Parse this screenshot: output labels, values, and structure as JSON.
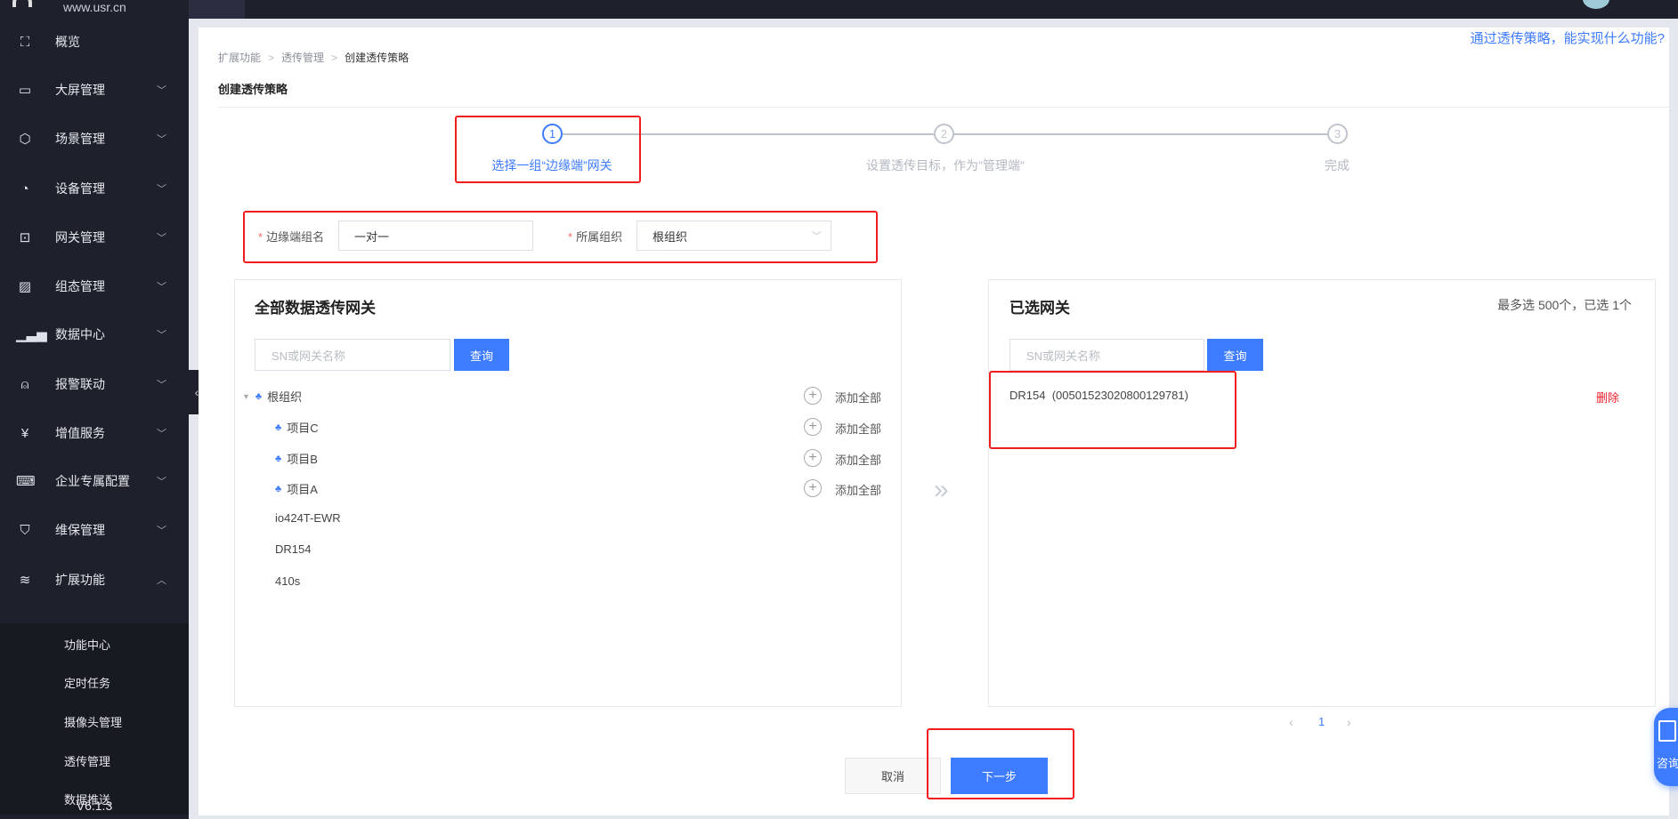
{
  "header": {
    "logo_url": "www.usr.cn"
  },
  "sidebar": {
    "items": [
      {
        "label": "概览",
        "icon": "overview-icon"
      },
      {
        "label": "大屏管理",
        "icon": "monitor-icon"
      },
      {
        "label": "场景管理",
        "icon": "cube-icon"
      },
      {
        "label": "设备管理",
        "icon": "pie-icon"
      },
      {
        "label": "网关管理",
        "icon": "gateway-icon"
      },
      {
        "label": "组态管理",
        "icon": "image-icon"
      },
      {
        "label": "数据中心",
        "icon": "bar-chart-icon"
      },
      {
        "label": "报警联动",
        "icon": "alarm-icon"
      },
      {
        "label": "增值服务",
        "icon": "yen-icon"
      },
      {
        "label": "企业专属配置",
        "icon": "code-monitor-icon"
      },
      {
        "label": "维保管理",
        "icon": "shield-icon"
      },
      {
        "label": "扩展功能",
        "icon": "layers-icon"
      }
    ],
    "subitems": [
      "功能中心",
      "定时任务",
      "摄像头管理",
      "透传管理",
      "数据推送"
    ],
    "version": "V6.1.3"
  },
  "breadcrumb": [
    "扩展功能",
    "透传管理",
    "创建透传策略"
  ],
  "help_link": "通过透传策略，能实现什么功能?",
  "page_title": "创建透传策略",
  "steps": [
    {
      "num": "1",
      "label": "选择一组“边缘端”网关",
      "active": true
    },
    {
      "num": "2",
      "label": "设置透传目标，作为\"管理端\"",
      "active": false
    },
    {
      "num": "3",
      "label": "完成",
      "active": false
    }
  ],
  "form": {
    "group_name_label": "边缘端组名",
    "group_name_value": "一对一",
    "org_label": "所属组织",
    "org_value": "根组织",
    "required_mark": "*"
  },
  "left_panel": {
    "title": "全部数据透传网关",
    "search_placeholder": "SN或网关名称",
    "search_button": "查询",
    "add_all_label": "添加全部",
    "tree": [
      {
        "label": "根组织",
        "type": "org"
      },
      {
        "label": "项目C",
        "type": "org"
      },
      {
        "label": "项目B",
        "type": "org"
      },
      {
        "label": "项目A",
        "type": "org"
      },
      {
        "label": "io424T-EWR",
        "type": "gateway"
      },
      {
        "label": "DR154",
        "type": "gateway"
      },
      {
        "label": "410s",
        "type": "gateway"
      }
    ]
  },
  "right_panel": {
    "title": "已选网关",
    "limit_text": "最多选 500个，已选 1个",
    "search_placeholder": "SN或网关名称",
    "search_button": "查询",
    "selected": [
      {
        "label": "DR154  (00501523020800129781)",
        "delete": "删除"
      }
    ],
    "pagination": {
      "current": "1"
    }
  },
  "buttons": {
    "cancel": "取消",
    "next": "下一步"
  },
  "float_widget": {
    "label": "咨询"
  },
  "colors": {
    "accent": "#3d7bff",
    "danger": "#f5222d",
    "sidebar": "#1e212b"
  }
}
